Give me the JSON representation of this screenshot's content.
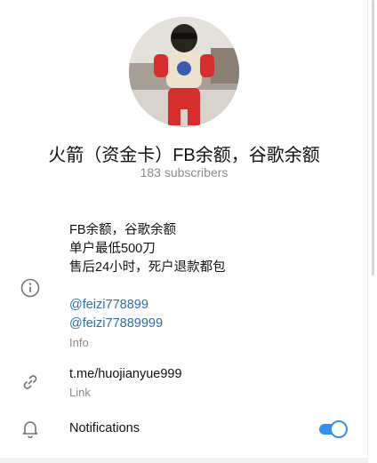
{
  "channel": {
    "title": "火箭（资金卡）FB余额，谷歌余额",
    "subscribers": "183 subscribers"
  },
  "info": {
    "lines": [
      "FB余额，谷歌余额",
      "单户最低500刀",
      "售后24小时，死户退款都包"
    ],
    "mentions": [
      "@feizi778899",
      "@feizi77889999"
    ],
    "label": "Info",
    "icon": "info-icon"
  },
  "link": {
    "value": "t.me/huojianyue999",
    "label": "Link",
    "icon": "link-icon"
  },
  "notifications": {
    "label": "Notifications",
    "enabled": true,
    "icon": "bell-icon"
  },
  "colors": {
    "accent": "#3390ec",
    "link": "#2f6ea5",
    "secondary_text": "#8a8a8a"
  }
}
